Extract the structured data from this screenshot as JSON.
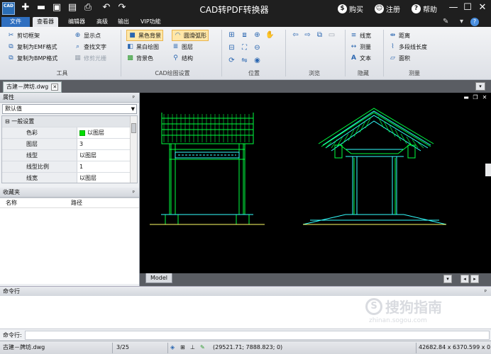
{
  "title_bar": {
    "logo_text": "CAD",
    "app_title": "CAD转PDF转换器",
    "buy_label": "购买",
    "register_label": "注册",
    "help_label": "帮助"
  },
  "menu": {
    "file": "文件",
    "tabs": [
      "查看器",
      "编辑器",
      "高级",
      "输出",
      "VIP功能"
    ]
  },
  "ribbon": {
    "tools": {
      "label": "工具",
      "items": [
        "剪切框架",
        "复制为EMF格式",
        "复制为BMP格式",
        "显示点",
        "查找文字",
        "修剪光栅"
      ]
    },
    "cad_settings": {
      "label": "CAD绘图设置",
      "items": [
        "黑色背景",
        "黑白绘图",
        "背景色",
        "圆滑弧形",
        "图层",
        "结构"
      ]
    },
    "position": {
      "label": "位置"
    },
    "browse": {
      "label": "浏览"
    },
    "hide": {
      "label": "隐藏",
      "items": [
        "线宽",
        "测量",
        "文本"
      ]
    },
    "measure": {
      "label": "测量",
      "items": [
        "距离",
        "多段线长度",
        "面积"
      ]
    }
  },
  "document_tab": {
    "name": "古建－牌坊.dwg"
  },
  "properties": {
    "title": "属性",
    "dropdown_value": "默认值",
    "category": "一般设置",
    "rows": [
      {
        "key": "色彩",
        "value": "以图层"
      },
      {
        "key": "图层",
        "value": "3"
      },
      {
        "key": "线型",
        "value": "以图层"
      },
      {
        "key": "线型比例",
        "value": "1"
      },
      {
        "key": "线宽",
        "value": "以图层"
      }
    ]
  },
  "favorites": {
    "title": "收藏夹",
    "columns": [
      "名称",
      "路径"
    ]
  },
  "layout_tab": "Model",
  "command": {
    "header": "命令行",
    "prompt": "命令行:"
  },
  "status": {
    "file": "古建－牌坊.dwg",
    "page": "3/25",
    "coords": "(29521.71; 7888.823; 0)",
    "size": "42682.84 x 6370.599 x 0"
  },
  "watermark": {
    "text": "搜狗指南",
    "url": "zhinan.sogou.com"
  },
  "colors": {
    "titlebar": "#1f1f1f",
    "file_tab": "#2f6fc0",
    "canvas_bg": "#000000",
    "drawing_green": "#00ff40",
    "drawing_cyan": "#33ffff"
  }
}
